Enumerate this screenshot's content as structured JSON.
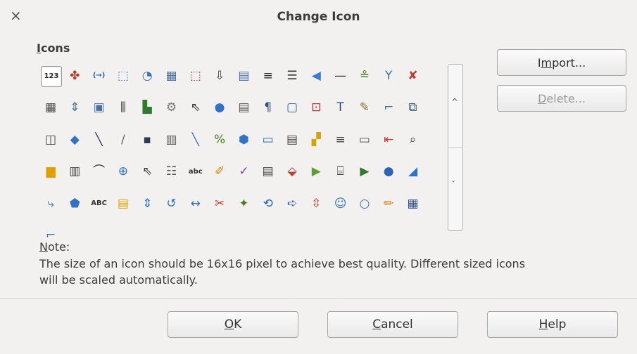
{
  "window": {
    "title": "Change Icon",
    "close_glyph": "×"
  },
  "icons_section": {
    "label_accel": "I",
    "label_rest": "cons"
  },
  "icons": [
    {
      "name": "123-number-icon",
      "glyph": "123",
      "color": "#2b2b2b",
      "kind": "text",
      "selected": true
    },
    {
      "name": "tools-icon",
      "glyph": "✤",
      "color": "#c0392b"
    },
    {
      "name": "arrow-brackets-icon",
      "glyph": "(→)",
      "color": "#2a64b6",
      "kind": "text"
    },
    {
      "name": "export-icon",
      "glyph": "⬚",
      "color": "#5a7fb5"
    },
    {
      "name": "chart-icon",
      "glyph": "◔",
      "color": "#3b6fb6"
    },
    {
      "name": "table-grid-icon",
      "glyph": "▦",
      "color": "#4b6fa3"
    },
    {
      "name": "insert-frame-icon",
      "glyph": "⬚",
      "color": "#c0392b"
    },
    {
      "name": "sort-az-icon",
      "glyph": "⇩",
      "color": "#3a3a3a"
    },
    {
      "name": "form-icon",
      "glyph": "▤",
      "color": "#4a6ea9"
    },
    {
      "name": "align-justify-icon",
      "glyph": "≡",
      "color": "#333"
    },
    {
      "name": "align-lines-icon",
      "glyph": "☰",
      "color": "#333"
    },
    {
      "name": "back-arrow-icon",
      "glyph": "◀",
      "color": "#3a7bd5"
    },
    {
      "name": "line-icon",
      "glyph": "—",
      "color": "#222"
    },
    {
      "name": "underline-icon",
      "glyph": "≗",
      "color": "#4a7c2a"
    },
    {
      "name": "network-icon",
      "glyph": "Y",
      "color": "#3a6ea8"
    },
    {
      "name": "delete-flag-icon",
      "glyph": "✘",
      "color": "#c0392b"
    },
    {
      "name": "table-icon",
      "glyph": "▦",
      "color": "#4a4a4a"
    },
    {
      "name": "resize-icon",
      "glyph": "⇕",
      "color": "#3a6ea8"
    },
    {
      "name": "group-icon",
      "glyph": "▣",
      "color": "#4a6ea9"
    },
    {
      "name": "columns-icon",
      "glyph": "⫼",
      "color": "#3a3a3a"
    },
    {
      "name": "chart-bars-icon",
      "glyph": "▙",
      "color": "#2f7a2f"
    },
    {
      "name": "settings-icon",
      "glyph": "⚙",
      "color": "#777"
    },
    {
      "name": "pointer-icon",
      "glyph": "⇖",
      "color": "#333"
    },
    {
      "name": "circle-icon",
      "glyph": "●",
      "color": "#2f72c9"
    },
    {
      "name": "sheet-icon",
      "glyph": "▤",
      "color": "#555"
    },
    {
      "name": "paragraph-icon",
      "glyph": "¶",
      "color": "#2a4f8c"
    },
    {
      "name": "rounded-rect-icon",
      "glyph": "▢",
      "color": "#2a64b6"
    },
    {
      "name": "field-icon",
      "glyph": "⊡",
      "color": "#c0392b"
    },
    {
      "name": "text-icon",
      "glyph": "T",
      "color": "#2a4f8c"
    },
    {
      "name": "magic-wand-icon",
      "glyph": "✎",
      "color": "#8a6a2a"
    },
    {
      "name": "connector-icon",
      "glyph": "⌐",
      "color": "#3a6ea8"
    },
    {
      "name": "insert-image-icon",
      "glyph": "⧉",
      "color": "#2a64b6"
    },
    {
      "name": "link-icon",
      "glyph": "◫",
      "color": "#444"
    },
    {
      "name": "diamond-icon",
      "glyph": "◆",
      "color": "#2f72c9"
    },
    {
      "name": "thick-line-icon",
      "glyph": "╲",
      "color": "#2b3a55"
    },
    {
      "name": "pencil-icon",
      "glyph": "/",
      "color": "#666"
    },
    {
      "name": "save-icon",
      "glyph": "▪",
      "color": "#2b3a55"
    },
    {
      "name": "document-icon",
      "glyph": "▥",
      "color": "#555"
    },
    {
      "name": "curve-icon",
      "glyph": "╲",
      "color": "#2f72c9"
    },
    {
      "name": "chart-percent-icon",
      "glyph": "%",
      "color": "#4a7c2a"
    },
    {
      "name": "hexagon-icon",
      "glyph": "⬢",
      "color": "#2f72c9"
    },
    {
      "name": "presentation-icon",
      "glyph": "▭",
      "color": "#2a64b6"
    },
    {
      "name": "form-fields-icon",
      "glyph": "▤",
      "color": "#444"
    },
    {
      "name": "color-blocks-icon",
      "glyph": "▞",
      "color": "#d6a400"
    },
    {
      "name": "center-align-icon",
      "glyph": "≡",
      "color": "#444"
    },
    {
      "name": "line-number-icon",
      "glyph": "▭",
      "color": "#555"
    },
    {
      "name": "indent-icon",
      "glyph": "⇤",
      "color": "#c0392b"
    },
    {
      "name": "zoom-icon",
      "glyph": "⌕",
      "color": "#444"
    },
    {
      "name": "callout-icon",
      "glyph": "▆",
      "color": "#e0a000"
    },
    {
      "name": "database-icon",
      "glyph": "▥",
      "color": "#444"
    },
    {
      "name": "arc-icon",
      "glyph": "⌒",
      "color": "#333"
    },
    {
      "name": "crosshair-icon",
      "glyph": "⊕",
      "color": "#2f72c9"
    },
    {
      "name": "select-icon",
      "glyph": "⇖",
      "color": "#333"
    },
    {
      "name": "list-icon",
      "glyph": "☷",
      "color": "#555"
    },
    {
      "name": "spellcheck-icon",
      "glyph": "abc",
      "color": "#333",
      "kind": "text"
    },
    {
      "name": "edit-icon",
      "glyph": "✐",
      "color": "#d08a00"
    },
    {
      "name": "draw-line-icon",
      "glyph": "✓",
      "color": "#7a3fb6"
    },
    {
      "name": "page-icon",
      "glyph": "▤",
      "color": "#444"
    },
    {
      "name": "color-fill-icon",
      "glyph": "⬙",
      "color": "#c0392b"
    },
    {
      "name": "autoplay-icon",
      "glyph": "▶",
      "color": "#5aa02c"
    },
    {
      "name": "cylinder-icon",
      "glyph": "⌸",
      "color": "#444"
    },
    {
      "name": "play-box-icon",
      "glyph": "▶",
      "color": "#2f7a2f"
    },
    {
      "name": "sphere-icon",
      "glyph": "●",
      "color": "#2a64b6"
    },
    {
      "name": "wedge-icon",
      "glyph": "◢",
      "color": "#2f72c9"
    },
    {
      "name": "connector-line-icon",
      "glyph": "⤷",
      "color": "#2f72c9"
    },
    {
      "name": "pentagon-icon",
      "glyph": "⬟",
      "color": "#2f72c9"
    },
    {
      "name": "abc-text-icon",
      "glyph": "ABC",
      "color": "#333",
      "kind": "text"
    },
    {
      "name": "note-icon",
      "glyph": "▤",
      "color": "#e0a000"
    },
    {
      "name": "vertical-arrows-icon",
      "glyph": "⇕",
      "color": "#2f72c9"
    },
    {
      "name": "undo-icon",
      "glyph": "↺",
      "color": "#2f72c9"
    },
    {
      "name": "horizontal-arrows-icon",
      "glyph": "↔",
      "color": "#2f72c9"
    },
    {
      "name": "cut-icon",
      "glyph": "✂",
      "color": "#c0392b"
    },
    {
      "name": "magic-icon",
      "glyph": "✦",
      "color": "#4a7c2a"
    },
    {
      "name": "replace-icon",
      "glyph": "⟲",
      "color": "#2a64b6"
    },
    {
      "name": "forward-arrow-icon",
      "glyph": "➪",
      "color": "#2f72c9"
    },
    {
      "name": "field-insert-icon",
      "glyph": "⇳",
      "color": "#c0392b"
    },
    {
      "name": "smiley-icon",
      "glyph": "☺",
      "color": "#2f72c9"
    },
    {
      "name": "circle-outline-icon",
      "glyph": "○",
      "color": "#2f72c9"
    },
    {
      "name": "highlighter-icon",
      "glyph": "✏",
      "color": "#e07a00"
    },
    {
      "name": "table-pointer-icon",
      "glyph": "▦",
      "color": "#2a4f8c"
    },
    {
      "name": "step-line-icon",
      "glyph": "⌐",
      "color": "#2f72c9"
    }
  ],
  "buttons": {
    "import": {
      "accel": "m",
      "before": "I",
      "after": "port..."
    },
    "delete": {
      "accel": "D",
      "before": "",
      "after": "elete..."
    },
    "ok": {
      "accel": "O",
      "before": "",
      "after": "K"
    },
    "cancel": {
      "accel": "C",
      "before": "",
      "after": "ancel"
    },
    "help": {
      "accel": "H",
      "before": "",
      "after": "elp"
    }
  },
  "note": {
    "label_accel": "N",
    "label_rest": "ote:",
    "text": "The size of an icon should be 16x16 pixel to achieve best quality. Different sized icons will be scaled automatically."
  },
  "scrollbar": {
    "up_glyph": "^",
    "down_glyph": "ˇ"
  }
}
